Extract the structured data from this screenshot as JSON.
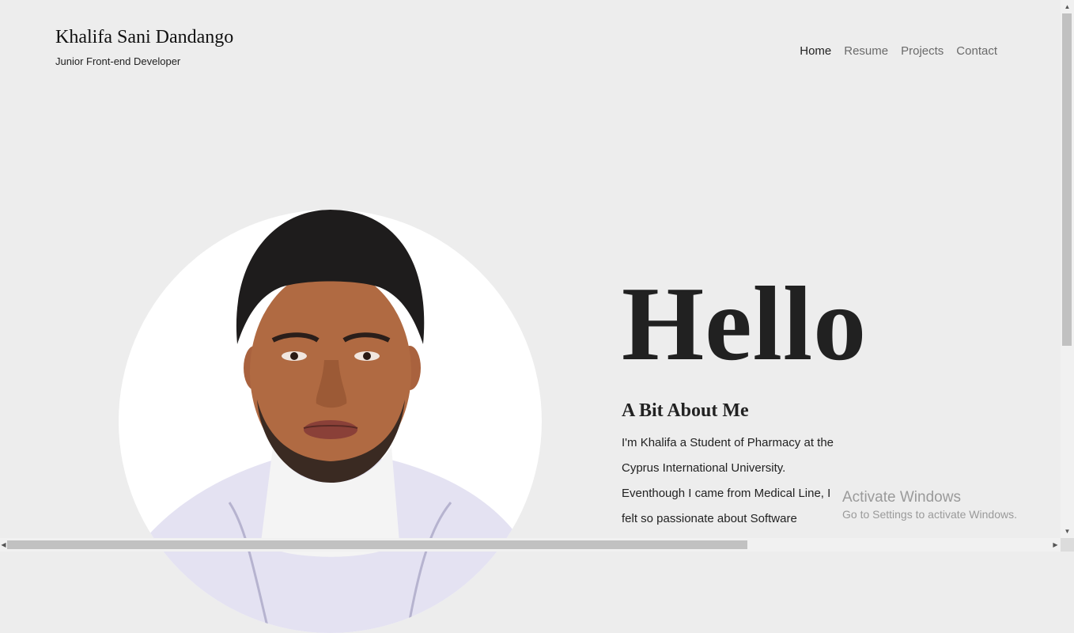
{
  "header": {
    "name": "Khalifa Sani Dandango",
    "tagline": "Junior Front-end Developer"
  },
  "nav": {
    "items": [
      {
        "label": "Home",
        "active": true
      },
      {
        "label": "Resume",
        "active": false
      },
      {
        "label": "Projects",
        "active": false
      },
      {
        "label": "Contact",
        "active": false
      }
    ]
  },
  "hero": {
    "greeting": "Hello",
    "about_title": "A Bit About Me",
    "about_text": "I'm Khalifa a Student of Pharmacy at the Cyprus International University. Eventhough I came from Medical Line, I felt so passionate about Software",
    "photo_alt": "Portrait of Khalifa Sani Dandango"
  },
  "windows_watermark": {
    "title": "Activate Windows",
    "subtitle": "Go to Settings to activate Windows."
  },
  "colors": {
    "background": "#ededed",
    "text": "#212121",
    "nav_inactive": "#6a6a6a"
  }
}
